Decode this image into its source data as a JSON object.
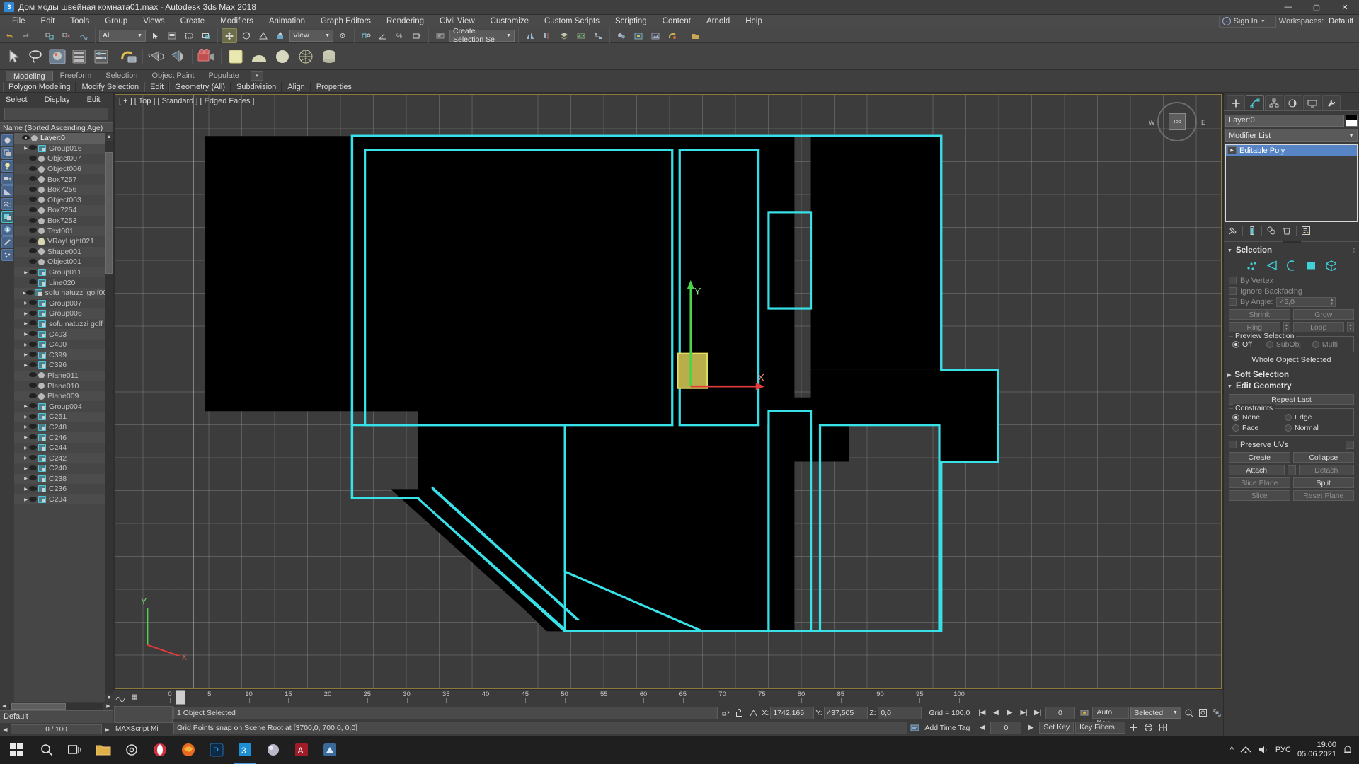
{
  "titlebar": {
    "app_icon": "max-logo-icon",
    "title": "Дом моды швейная комната01.max - Autodesk 3ds Max 2018",
    "minimize": "—",
    "maximize": "▢",
    "close": "✕"
  },
  "menubar": {
    "items": [
      "File",
      "Edit",
      "Tools",
      "Group",
      "Views",
      "Create",
      "Modifiers",
      "Animation",
      "Graph Editors",
      "Rendering",
      "Civil View",
      "Customize",
      "Custom Scripts",
      "Scripting",
      "Content",
      "Arnold",
      "Help"
    ],
    "signin": "Sign In",
    "workspaces_label": "Workspaces:",
    "workspaces_value": "Default"
  },
  "toolbar": {
    "filter_value": "All",
    "view_value": "View",
    "selection_set_placeholder": "Create Selection Se"
  },
  "ribbon": {
    "tabs": [
      "Modeling",
      "Freeform",
      "Selection",
      "Object Paint",
      "Populate"
    ],
    "active_tab": "Modeling",
    "panels": [
      "Polygon Modeling",
      "Modify Selection",
      "Edit",
      "Geometry (All)",
      "Subdivision",
      "Align",
      "Properties"
    ]
  },
  "scene_explorer": {
    "menu": [
      "Select",
      "Display",
      "Edit"
    ],
    "search_value": "",
    "column_header": "Name (Sorted Ascending Age)",
    "items": [
      {
        "label": "Layer:0",
        "type": "layer",
        "indent": 0,
        "expandable": false,
        "selected": true,
        "visible": true
      },
      {
        "label": "Group016",
        "type": "group",
        "indent": 1,
        "expandable": true
      },
      {
        "label": "Object007",
        "type": "object",
        "indent": 1,
        "expandable": false
      },
      {
        "label": "Object006",
        "type": "object",
        "indent": 1,
        "expandable": false
      },
      {
        "label": "Box7257",
        "type": "object",
        "indent": 1,
        "expandable": false
      },
      {
        "label": "Box7256",
        "type": "object",
        "indent": 1,
        "expandable": false
      },
      {
        "label": "Object003",
        "type": "object",
        "indent": 1,
        "expandable": false
      },
      {
        "label": "Box7254",
        "type": "object",
        "indent": 1,
        "expandable": false
      },
      {
        "label": "Box7253",
        "type": "object",
        "indent": 1,
        "expandable": false
      },
      {
        "label": "Text001",
        "type": "object",
        "indent": 1,
        "expandable": false
      },
      {
        "label": "VRayLight021",
        "type": "light",
        "indent": 1,
        "expandable": false
      },
      {
        "label": "Shape001",
        "type": "object",
        "indent": 1,
        "expandable": false
      },
      {
        "label": "Object001",
        "type": "object",
        "indent": 1,
        "expandable": false
      },
      {
        "label": "Group011",
        "type": "group",
        "indent": 1,
        "expandable": true
      },
      {
        "label": "Line020",
        "type": "shape",
        "indent": 1,
        "expandable": false
      },
      {
        "label": "sofu natuzzi golf00",
        "type": "group",
        "indent": 1,
        "expandable": true
      },
      {
        "label": "Group007",
        "type": "group",
        "indent": 1,
        "expandable": true
      },
      {
        "label": "Group006",
        "type": "group",
        "indent": 1,
        "expandable": true
      },
      {
        "label": "sofu natuzzi golf",
        "type": "group",
        "indent": 1,
        "expandable": true
      },
      {
        "label": "C403",
        "type": "group",
        "indent": 1,
        "expandable": true
      },
      {
        "label": "C400",
        "type": "group",
        "indent": 1,
        "expandable": true
      },
      {
        "label": "C399",
        "type": "group",
        "indent": 1,
        "expandable": true
      },
      {
        "label": "C396",
        "type": "group",
        "indent": 1,
        "expandable": true
      },
      {
        "label": "Plane011",
        "type": "object",
        "indent": 1,
        "expandable": false
      },
      {
        "label": "Plane010",
        "type": "object",
        "indent": 1,
        "expandable": false
      },
      {
        "label": "Plane009",
        "type": "object",
        "indent": 1,
        "expandable": false
      },
      {
        "label": "Group004",
        "type": "group",
        "indent": 1,
        "expandable": true
      },
      {
        "label": "C251",
        "type": "group",
        "indent": 1,
        "expandable": true
      },
      {
        "label": "C248",
        "type": "group",
        "indent": 1,
        "expandable": true
      },
      {
        "label": "C246",
        "type": "group",
        "indent": 1,
        "expandable": true
      },
      {
        "label": "C244",
        "type": "group",
        "indent": 1,
        "expandable": true
      },
      {
        "label": "C242",
        "type": "group",
        "indent": 1,
        "expandable": true
      },
      {
        "label": "C240",
        "type": "group",
        "indent": 1,
        "expandable": true
      },
      {
        "label": "C238",
        "type": "group",
        "indent": 1,
        "expandable": true
      },
      {
        "label": "C236",
        "type": "group",
        "indent": 1,
        "expandable": true
      },
      {
        "label": "C234",
        "type": "group",
        "indent": 1,
        "expandable": true
      }
    ],
    "footer_layer": "Default",
    "frame_field": "0 / 100"
  },
  "viewport": {
    "label": "[ + ] [ Top ] [ Standard ] [ Edged Faces ]",
    "viewcube_top": "Top",
    "viewcube_w": "W",
    "viewcube_e": "E",
    "edge_color": "#38e0e8",
    "fill_color": "#000000",
    "gizmo_y": "Y",
    "gizmo_x": "X"
  },
  "timeslider": {
    "ticks": [
      0,
      5,
      10,
      15,
      20,
      25,
      30,
      35,
      40,
      45,
      50,
      55,
      60,
      65,
      70,
      75,
      80,
      85,
      90,
      95,
      100
    ],
    "current_frame": "0 / 100"
  },
  "statusbar": {
    "maxscript_label": "MAXScript Mi",
    "selection_text": "1 Object Selected",
    "prompt_text": "Grid Points snap on Scene Root at [3700,0, 700,0, 0,0]",
    "coords": [
      {
        "axis": "X:",
        "value": "1742,165"
      },
      {
        "axis": "Y:",
        "value": "437,505"
      },
      {
        "axis": "Z:",
        "value": "0,0"
      }
    ],
    "grid_text": "Grid = 100,0",
    "add_time_tag": "Add Time Tag",
    "auto_key": "Auto Key",
    "set_key": "Set Key",
    "selected_dd": "Selected",
    "key_filters": "Key Filters...",
    "key_field": "0"
  },
  "command_panel": {
    "tabs": [
      "create-tab",
      "modify-tab",
      "hierarchy-tab",
      "motion-tab",
      "display-tab",
      "utilities-tab"
    ],
    "active_tab": "modify-tab",
    "object_name": "Layer:0",
    "modifier_list_label": "Modifier List",
    "stack_items": [
      "Editable Poly"
    ],
    "selection": {
      "title": "Selection",
      "sub_levels": [
        "vertex-icon",
        "edge-icon",
        "border-icon",
        "polygon-icon",
        "element-icon"
      ],
      "by_vertex": "By Vertex",
      "ignore_backfacing": "Ignore Backfacing",
      "by_angle": "By Angle:",
      "by_angle_value": "45,0",
      "shrink": "Shrink",
      "grow": "Grow",
      "ring": "Ring",
      "loop": "Loop",
      "preview_selection": "Preview Selection",
      "preview_options": [
        "Off",
        "SubObj",
        "Multi"
      ],
      "preview_selected": "Off",
      "status": "Whole Object Selected"
    },
    "soft_selection": {
      "title": "Soft Selection"
    },
    "edit_geometry": {
      "title": "Edit Geometry",
      "repeat_last": "Repeat Last",
      "constraints_label": "Constraints",
      "constraints": [
        "None",
        "Edge",
        "Face",
        "Normal"
      ],
      "constraint_selected": "None",
      "preserve_uvs": "Preserve UVs",
      "create": "Create",
      "collapse": "Collapse",
      "attach": "Attach",
      "detach": "Detach",
      "slice_plane": "Slice Plane",
      "split": "Split",
      "slice": "Slice",
      "reset_plane": "Reset Plane"
    }
  },
  "taskbar": {
    "apps": [
      "start-icon",
      "search-icon",
      "task-view-icon",
      "folder-icon",
      "settings-icon",
      "opera-icon",
      "firefox-icon",
      "photoshop-icon",
      "max-icon",
      "sphere-icon",
      "autocad-icon",
      "app-icon"
    ],
    "tray_lang": "РУС",
    "time": "19:00",
    "date": "05.06.2021",
    "chevron": "^"
  }
}
